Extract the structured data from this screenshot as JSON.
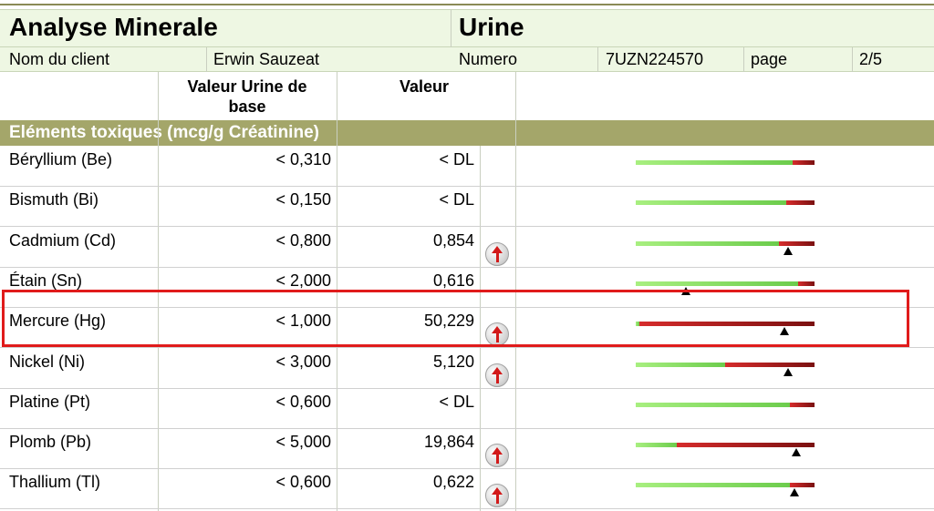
{
  "header": {
    "title": "Analyse Minerale",
    "sample_type": "Urine"
  },
  "info": {
    "client_label": "Nom du client",
    "client_name": "Erwin Sauzeat",
    "number_label": "Numero",
    "number_value": "7UZN224570",
    "page_label": "page",
    "page_value": "2/5"
  },
  "columns": {
    "base": "Valeur Urine de base",
    "value": "Valeur"
  },
  "section": {
    "title": "Eléments toxiques (mcg/g Créatinine)"
  },
  "rows": [
    {
      "element": "Béryllium (Be)",
      "base": "< 0,310",
      "value": "< DL",
      "high": false,
      "green_fraction": 0.88,
      "marker": null
    },
    {
      "element": "Bismuth (Bi)",
      "base": "< 0,150",
      "value": "< DL",
      "high": false,
      "green_fraction": 0.84,
      "marker": null
    },
    {
      "element": "Cadmium (Cd)",
      "base": "< 0,800",
      "value": "0,854",
      "high": true,
      "green_fraction": 0.8,
      "marker": 0.85
    },
    {
      "element": "Étain (Sn)",
      "base": "< 2,000",
      "value": "0,616",
      "high": false,
      "green_fraction": 0.91,
      "marker": 0.28
    },
    {
      "element": "Mercure (Hg)",
      "base": "< 1,000",
      "value": "50,229",
      "high": true,
      "green_fraction": 0.02,
      "marker": 0.83
    },
    {
      "element": "Nickel (Ni)",
      "base": "< 3,000",
      "value": "5,120",
      "high": true,
      "green_fraction": 0.5,
      "marker": 0.85
    },
    {
      "element": "Platine (Pt)",
      "base": "< 0,600",
      "value": "< DL",
      "high": false,
      "green_fraction": 0.86,
      "marker": null
    },
    {
      "element": "Plomb (Pb)",
      "base": "< 5,000",
      "value": "19,864",
      "high": true,
      "green_fraction": 0.23,
      "marker": 0.9
    },
    {
      "element": "Thallium (Tl)",
      "base": "< 0,600",
      "value": "0,622",
      "high": true,
      "green_fraction": 0.86,
      "marker": 0.89
    }
  ],
  "highlighted_element": "Mercure (Hg)",
  "colors": {
    "title_bg": "#eef7e3",
    "section_bg": "#a4a66a",
    "range_green": "#6ccc4c",
    "range_red": "#9c1a1a",
    "highlight": "#e01b1b",
    "up_arrow": "#d21a1a"
  },
  "icons": {
    "high_indicator": "red-up-arrow-icon",
    "marker": "black-triangle-marker"
  }
}
